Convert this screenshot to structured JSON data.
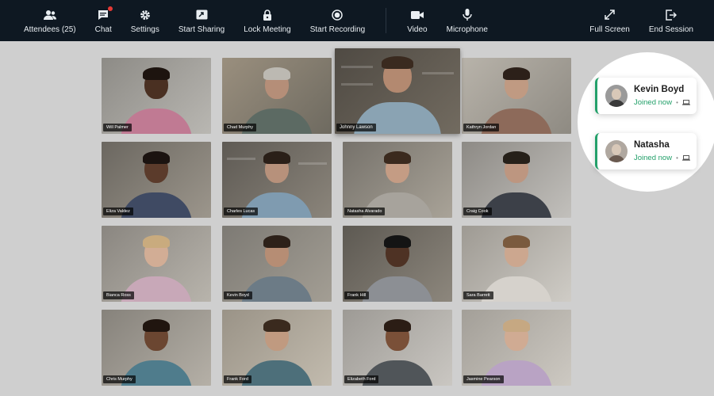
{
  "toolbar": {
    "attendees_label": "Attendees (25)",
    "chat_label": "Chat",
    "settings_label": "Settings",
    "start_sharing_label": "Start Sharing",
    "lock_meeting_label": "Lock Meeting",
    "start_recording_label": "Start Recording",
    "video_label": "Video",
    "microphone_label": "Microphone",
    "full_screen_label": "Full Screen",
    "end_session_label": "End Session"
  },
  "participants": [
    "Will Palmer",
    "Chad Murphy",
    "Johnny Lawson",
    "Kathryn Jordan",
    "Eliza Valdez",
    "Charles Lucas",
    "Natasha Alvarado",
    "Craig Cook",
    "Bianca Ross",
    "Kevin Boyd",
    "Frank Hill",
    "Sara Barrett",
    "Chris Murphy",
    "Frank Ford",
    "Elizabeth Ford",
    "Jasmine Pearson"
  ],
  "join_notifications": [
    {
      "name": "Kevin Boyd",
      "status": "Joined now"
    },
    {
      "name": "Natasha",
      "status": "Joined now"
    }
  ],
  "colors": {
    "toolbar_bg": "#0e1822",
    "accent_green": "#23a06a",
    "badge_red": "#e53935"
  }
}
